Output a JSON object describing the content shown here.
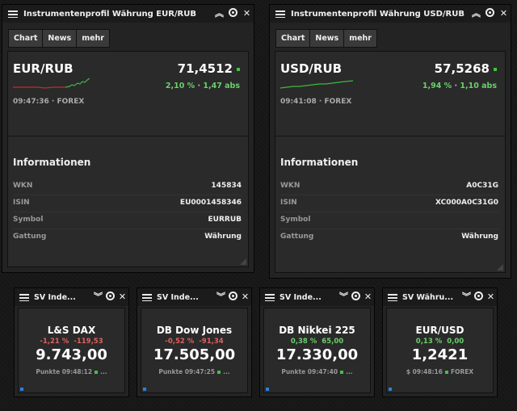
{
  "colors": {
    "positive": "#6ad16a",
    "negative": "#e06060",
    "accent": "#2f7fd8"
  },
  "icons": [
    "menu-icon",
    "collapse-icon",
    "target-icon",
    "close-icon"
  ],
  "panels": [
    {
      "title": "Instrumentenprofil Währung EUR/RUB",
      "tabs": [
        "Chart",
        "News",
        "mehr"
      ],
      "pair": "EUR/RUB",
      "price": "71,4512",
      "change_pct": "2,10 %",
      "separator": "·",
      "change_abs": "1,47 abs",
      "time": "09:47:36",
      "exchange": "FOREX",
      "info_heading": "Informationen",
      "info": [
        {
          "key": "WKN",
          "value": "145834"
        },
        {
          "key": "ISIN",
          "value": "EU0001458346"
        },
        {
          "key": "Symbol",
          "value": "EURRUB"
        },
        {
          "key": "Gattung",
          "value": "Währung"
        }
      ]
    },
    {
      "title": "Instrumentenprofil Währung USD/RUB",
      "tabs": [
        "Chart",
        "News",
        "mehr"
      ],
      "pair": "USD/RUB",
      "price": "57,5268",
      "change_pct": "1,94 %",
      "separator": "·",
      "change_abs": "1,10 abs",
      "time": "09:41:08",
      "exchange": "FOREX",
      "info_heading": "Informationen",
      "info": [
        {
          "key": "WKN",
          "value": "A0C31G"
        },
        {
          "key": "ISIN",
          "value": "XC000A0C31G0"
        },
        {
          "key": "Symbol",
          "value": ""
        },
        {
          "key": "Gattung",
          "value": "Währung"
        }
      ]
    }
  ],
  "indices": [
    {
      "title": "SV Inde...",
      "name": "L&S DAX",
      "pct": "-1,21 %",
      "abs": "-119,53",
      "value": "9.743,00",
      "foot": "Punkte 09:48:12",
      "more": "..."
    },
    {
      "title": "SV Inde...",
      "name": "DB Dow Jones",
      "pct": "-0,52 %",
      "abs": "-91,34",
      "value": "17.505,00",
      "foot": "Punkte 09:47:25",
      "more": "..."
    },
    {
      "title": "SV Inde...",
      "name": "DB Nikkei 225",
      "pct": "0,38 %",
      "abs": "65,00",
      "value": "17.330,00",
      "foot": "Punkte 09:47:40",
      "more": "..."
    },
    {
      "title": "SV Währu...",
      "name": "EUR/USD",
      "pct": "0,13 %",
      "abs": "0,00",
      "value": "1,2421",
      "foot": "$ 09:48:16",
      "more": "FOREX"
    }
  ]
}
